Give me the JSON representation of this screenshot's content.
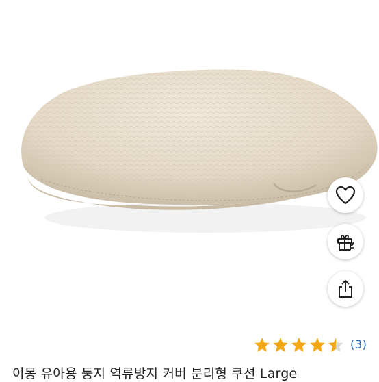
{
  "product": {
    "title": "이몽 유아용 둥지 역류방지 커버 분리형 쿠션 Large",
    "image_icon": "baby-nest-cushion-photo"
  },
  "actions": {
    "favorite_icon": "heart-icon",
    "gift_icon": "gift-icon",
    "share_icon": "share-icon"
  },
  "rating": {
    "stars": 4.5,
    "max_stars": 5,
    "count": "(3)"
  },
  "colors": {
    "star": "#f3a712",
    "star_empty": "#d9d9d9",
    "link": "#2a6ebb",
    "cushion": "#e6dccb"
  }
}
